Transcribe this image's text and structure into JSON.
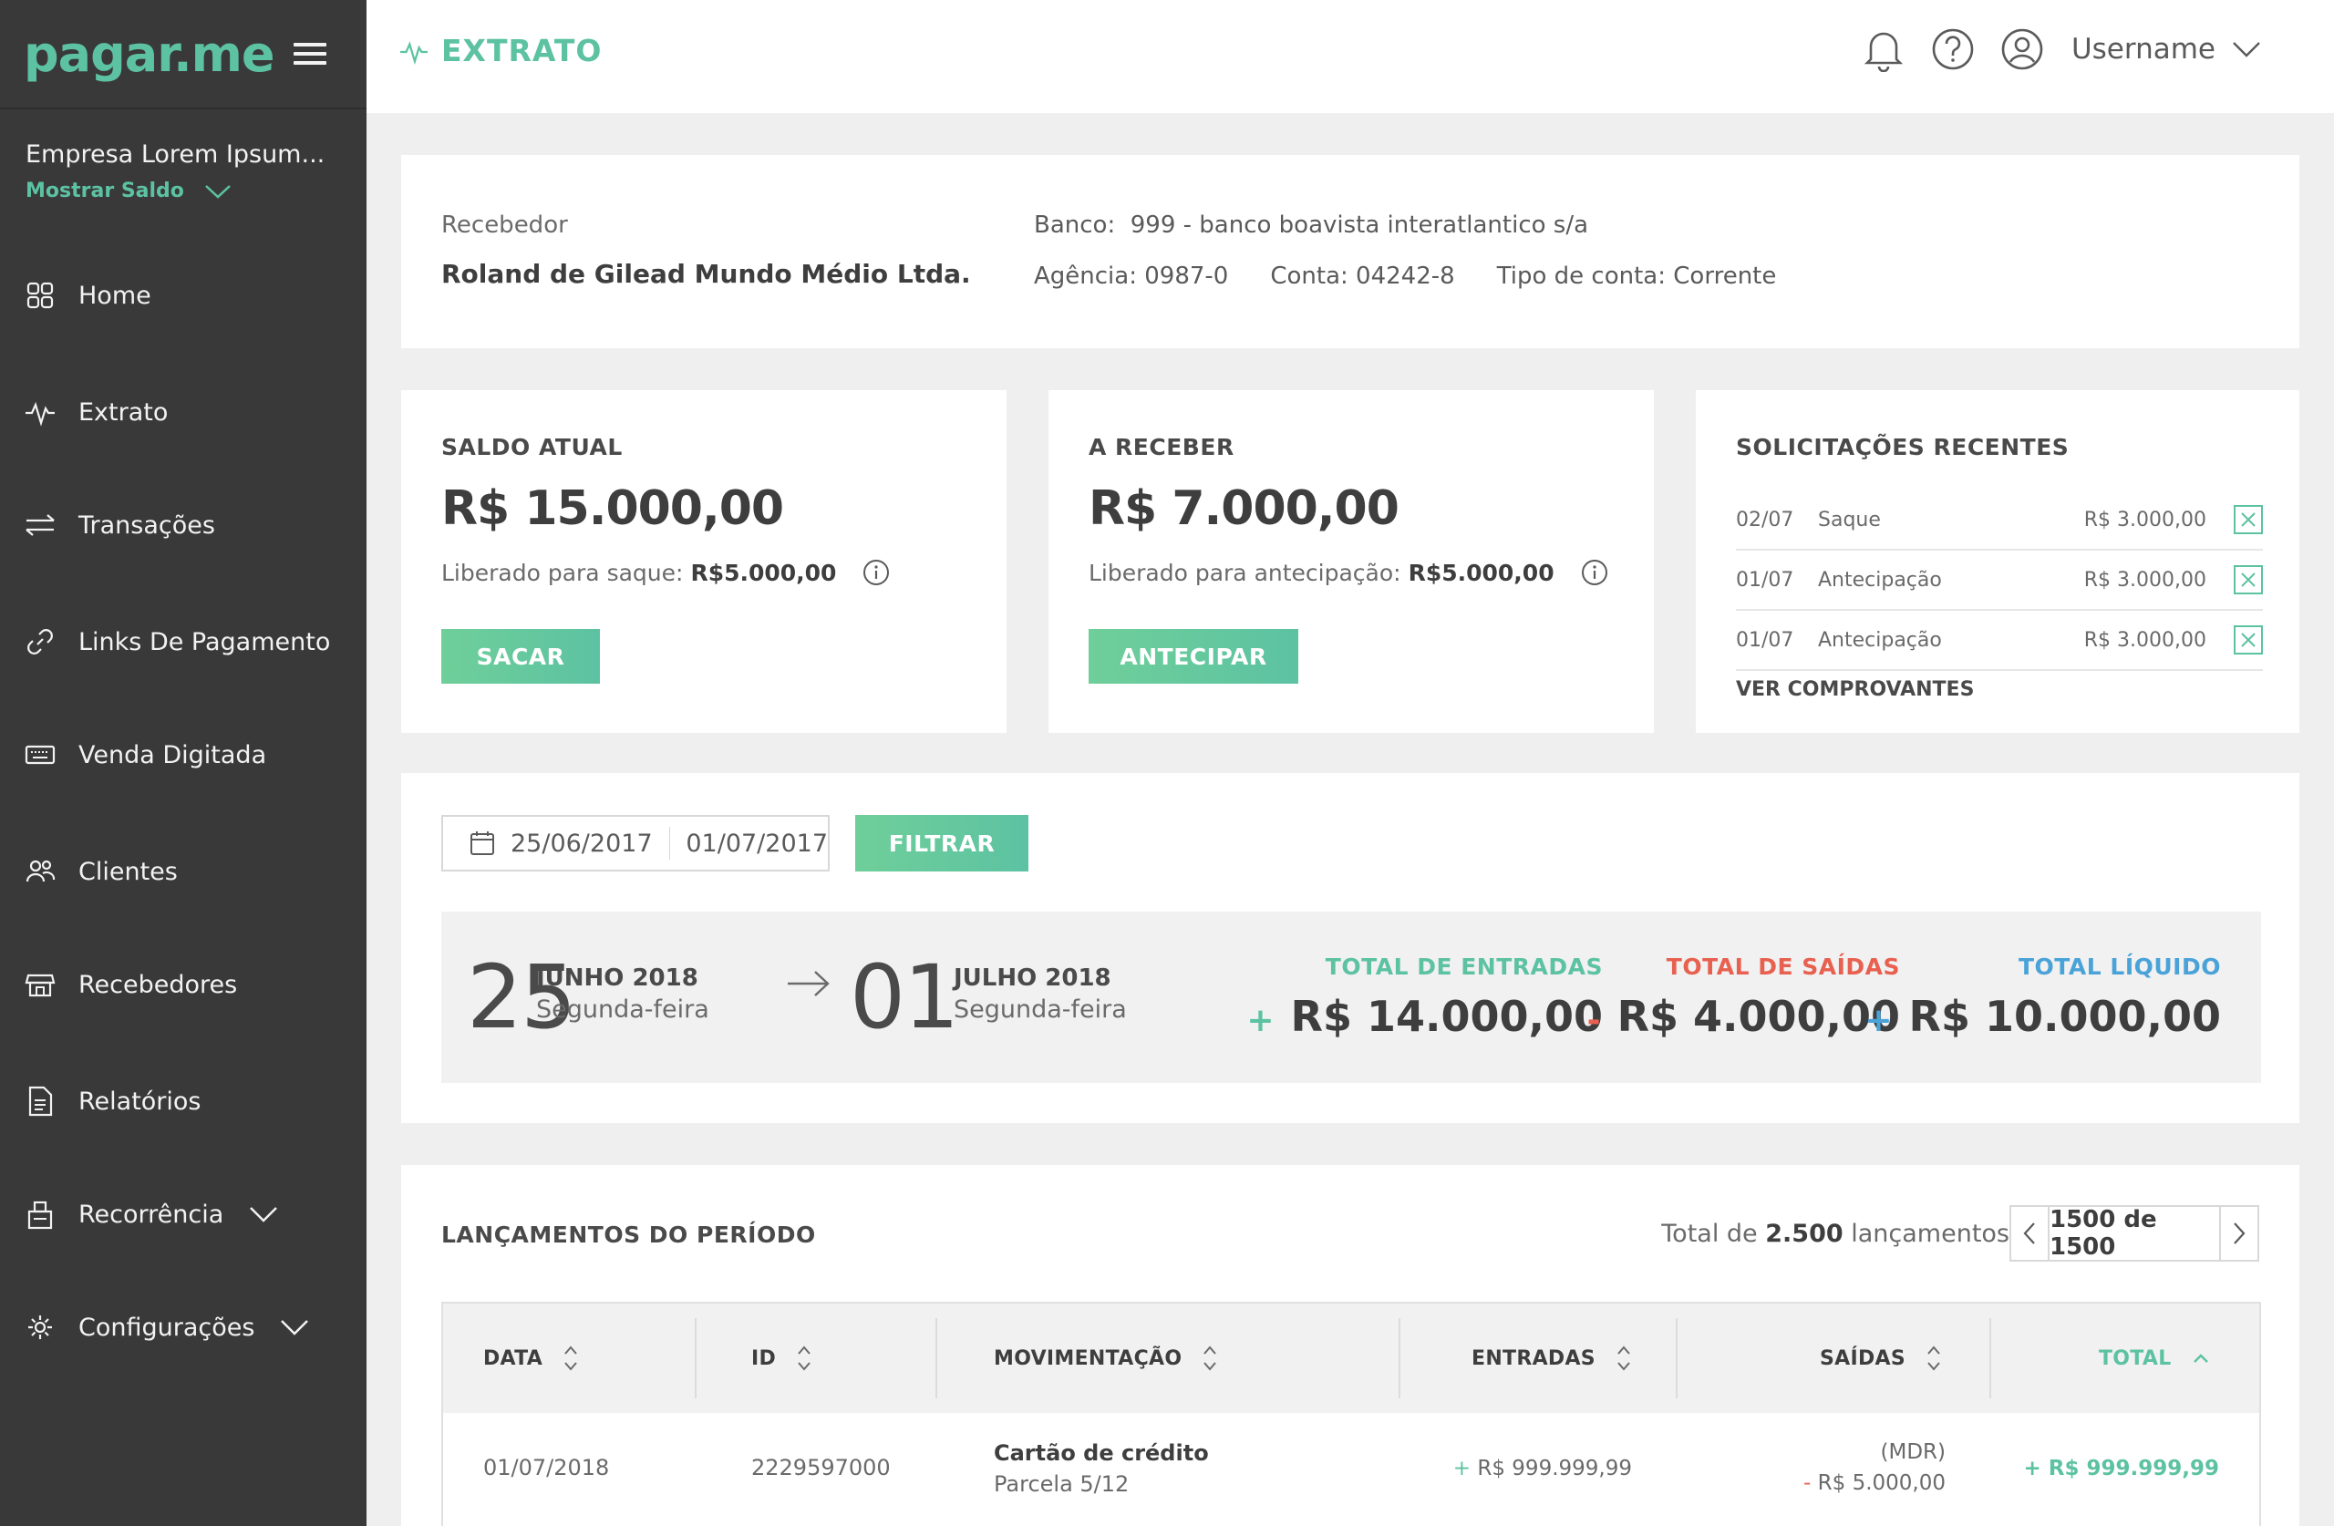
{
  "brand": {
    "logo": "pagar.me",
    "accent": "#5cc2a2"
  },
  "company": {
    "name": "Empresa Lorem Ipsum...",
    "toggle_label": "Mostrar Saldo"
  },
  "nav": {
    "items": [
      {
        "label": "Home",
        "icon": "grid-icon"
      },
      {
        "label": "Extrato",
        "icon": "pulse-icon"
      },
      {
        "label": "Transações",
        "icon": "transfer-icon"
      },
      {
        "label": "Links De Pagamento",
        "icon": "link-icon"
      },
      {
        "label": "Venda Digitada",
        "icon": "keyboard-icon"
      },
      {
        "label": "Clientes",
        "icon": "users-icon"
      },
      {
        "label": "Recebedores",
        "icon": "store-icon"
      },
      {
        "label": "Relatórios",
        "icon": "document-icon"
      },
      {
        "label": "Recorrência",
        "icon": "recurrence-icon"
      },
      {
        "label": "Configurações",
        "icon": "gear-icon"
      }
    ]
  },
  "header": {
    "title": "EXTRATO",
    "username": "Username"
  },
  "recebedor": {
    "label": "Recebedor",
    "name": "Roland de Gilead Mundo Médio Ltda.",
    "bank_label": "Banco:",
    "bank": "999 - banco boavista interatlantico s/a",
    "agency_label": "Agência:",
    "agency": "0987-0",
    "account_label": "Conta:",
    "account": "04242-8",
    "type_label": "Tipo de conta:",
    "type": "Corrente"
  },
  "saldo": {
    "title": "SALDO ATUAL",
    "value": "R$ 15.000,00",
    "sub_label": "Liberado para saque:",
    "sub_value": "R$5.000,00",
    "button": "SACAR"
  },
  "areceber": {
    "title": "A RECEBER",
    "value": "R$ 7.000,00",
    "sub_label": "Liberado para antecipação:",
    "sub_value": "R$5.000,00",
    "button": "ANTECIPAR"
  },
  "solicitacoes": {
    "title": "SOLICITAÇÕES RECENTES",
    "rows": [
      {
        "date": "02/07",
        "type": "Saque",
        "value": "R$ 3.000,00"
      },
      {
        "date": "01/07",
        "type": "Antecipação",
        "value": "R$ 3.000,00"
      },
      {
        "date": "01/07",
        "type": "Antecipação",
        "value": "R$ 3.000,00"
      }
    ],
    "link": "VER COMPROVANTES"
  },
  "filter": {
    "start": "25/06/2017",
    "end": "01/07/2017",
    "button": "FILTRAR"
  },
  "period": {
    "start_day": "25",
    "start_month": "JUNHO 2018",
    "start_weekday": "Segunda-feira",
    "end_day": "01",
    "end_month": "JULHO 2018",
    "end_weekday": "Segunda-feira",
    "entradas_label": "TOTAL DE ENTRADAS",
    "entradas_sign": "+",
    "entradas_value": "R$ 14.000,00",
    "saidas_label": "TOTAL DE SAÍDAS",
    "saidas_sign": "-",
    "saidas_value": "R$ 4.000,00",
    "liquido_label": "TOTAL LÍQUIDO",
    "liquido_sign": "+",
    "liquido_value": "R$ 10.000,00",
    "colors": {
      "entradas": "#5cc2a2",
      "saidas": "#e8604f",
      "liquido": "#4aa3d8"
    }
  },
  "lancamentos": {
    "title": "LANÇAMENTOS DO PERÍODO",
    "total_prefix": "Total de",
    "total_count": "2.500",
    "total_suffix": "lançamentos",
    "pager": "1500 de 1500",
    "columns": [
      "DATA",
      "ID",
      "MOVIMENTAÇÃO",
      "ENTRADAS",
      "SAÍDAS",
      "TOTAL"
    ],
    "rows": [
      {
        "date": "01/07/2018",
        "id": "2229597000",
        "mov_title": "Cartão de crédito",
        "mov_sub": "Parcela 5/12",
        "entrada_sign": "+",
        "entrada": "R$ 999.999,99",
        "saida_note": "(MDR)",
        "saida_sign": "-",
        "saida": "R$ 5.000,00",
        "total_sign": "+",
        "total": "R$ 999.999,99"
      }
    ]
  }
}
